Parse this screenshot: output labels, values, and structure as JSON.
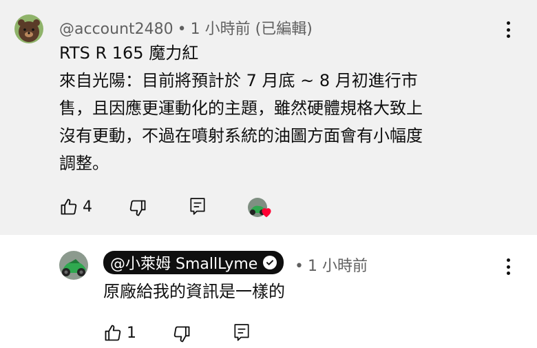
{
  "comment": {
    "author": "@account2480",
    "time": "1 小時前 (已編輯)",
    "separator": "•",
    "lines": [
      "RTS R 165 魔力紅",
      "來自光陽：目前將預計於 7 月底 ~ 8 月初進行市",
      "售，且因應更運動化的主題，雖然硬體規格大致上",
      "沒有更動，不過在噴射系統的油圖方面會有小幅度",
      "調整。"
    ],
    "like_count": "4",
    "icons": {
      "like": "thumbs-up-icon",
      "dislike": "thumbs-down-icon",
      "reply": "reply-icon",
      "heart": "creator-heart-icon",
      "menu": "more-vert-icon"
    }
  },
  "reply": {
    "author": "@小萊姆 SmallLyme",
    "time": "1 小時前",
    "separator": "•",
    "text": "原廠給我的資訊是一樣的",
    "like_count": "1",
    "verified": "verified-check-icon"
  },
  "colors": {
    "top_background": "#f1f1f1",
    "heart": "#ff0033",
    "author_chip": "#0f0f0f"
  }
}
